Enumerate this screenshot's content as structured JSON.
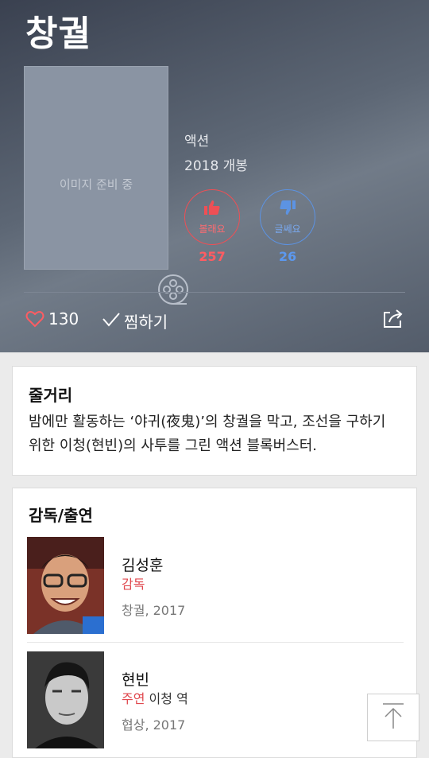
{
  "movie": {
    "title": "창궐",
    "poster_placeholder": "이미지 준비 중",
    "genre": "액션",
    "release": "2018 개봉"
  },
  "votes": {
    "like_label": "볼래요",
    "like_count": "257",
    "dislike_label": "글쎄요",
    "dislike_count": "26",
    "like_color": "#ef4f55",
    "dislike_color": "#5c93e3"
  },
  "actions": {
    "likes": "130",
    "wish_label": "찜하기"
  },
  "plot": {
    "heading": "줄거리",
    "text": "밤에만 활동하는 ‘야귀(夜鬼)’의 창궐을 막고, 조선을 구하기 위한 이청(현빈)의 사투를 그린 액션 블록버스터."
  },
  "cast": {
    "heading": "감독/출연",
    "people": [
      {
        "name": "김성훈",
        "role": "감독",
        "character": "",
        "work": "창궐, 2017"
      },
      {
        "name": "현빈",
        "role": "주연",
        "character": " 이청 역",
        "work": "협상, 2017"
      }
    ]
  }
}
